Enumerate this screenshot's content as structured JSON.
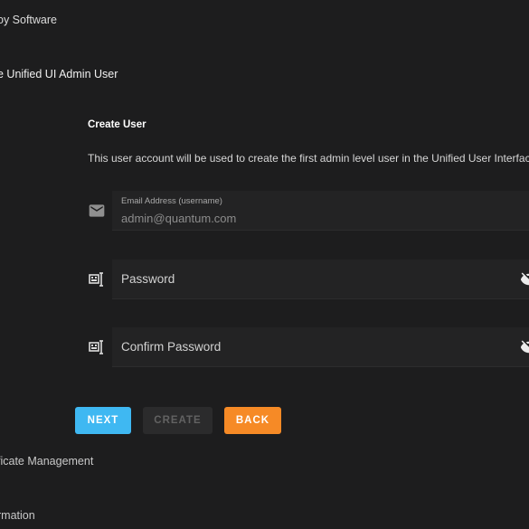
{
  "steps": {
    "software": "oy Software",
    "admin_user": "e Unified UI Admin User",
    "certificate": "ficate Management",
    "information": "rmation"
  },
  "create_user": {
    "title": "Create User",
    "description": "This user account will be used to create the first admin level user in the Unified User Interface."
  },
  "fields": {
    "email": {
      "label": "Email Address (username)",
      "value": "admin@quantum.com",
      "icon": "mail-icon"
    },
    "password": {
      "placeholder": "Password",
      "icon": "keyboard-password-icon",
      "toggle_icon": "visibility-off-icon"
    },
    "confirm_password": {
      "placeholder": "Confirm Password",
      "icon": "keyboard-password-icon",
      "toggle_icon": "visibility-off-icon"
    }
  },
  "buttons": {
    "next": "NEXT",
    "create": "CREATE",
    "back": "BACK"
  },
  "colors": {
    "background": "#1d1d1e",
    "next": "#3fb8f2",
    "back": "#f68a26",
    "create_disabled": "#2b2b2c"
  }
}
